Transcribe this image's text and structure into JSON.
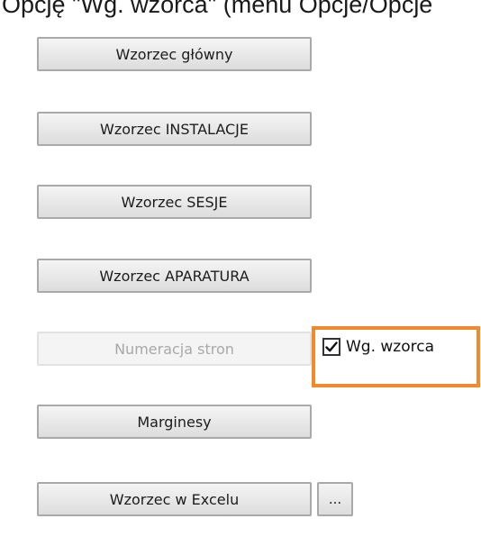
{
  "caption": "Opcję \"Wg. wzorca\" (menu Opcje/Opcje",
  "buttons": {
    "main_template": "Wzorzec główny",
    "installations_template": "Wzorzec INSTALACJE",
    "sessions_template": "Wzorzec SESJE",
    "equipment_template": "Wzorzec APARATURA",
    "page_numbering": "Numeracja stron",
    "margins": "Marginesy",
    "excel_template": "Wzorzec w Excelu",
    "browse": "..."
  },
  "checkbox": {
    "label": "Wg. wzorca",
    "checked": true
  },
  "colors": {
    "highlight": "#f28a2b"
  }
}
